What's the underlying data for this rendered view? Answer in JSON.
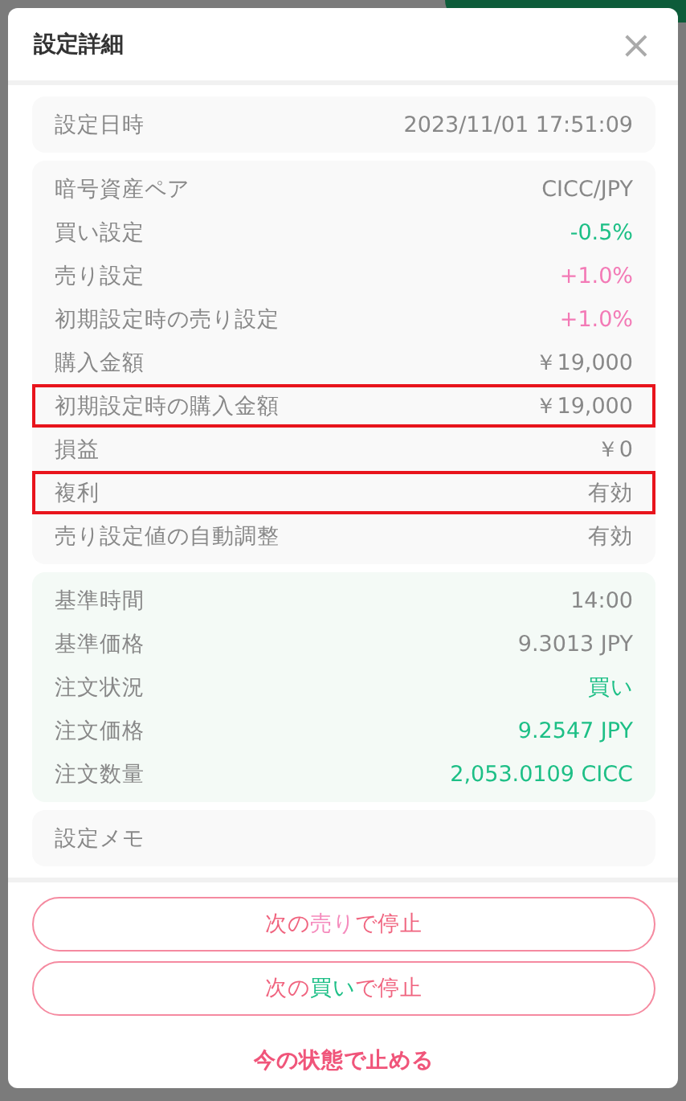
{
  "dialog": {
    "title": "設定詳細",
    "close": "×"
  },
  "sections": [
    {
      "rows": [
        {
          "label": "設定日時",
          "value": "2023/11/01 17:51:09",
          "kind": "plain",
          "highlighted": false
        }
      ]
    },
    {
      "rows": [
        {
          "label": "暗号資産ペア",
          "value": "CICC/JPY",
          "kind": "plain",
          "highlighted": false
        },
        {
          "label": "買い設定",
          "value": "-0.5%",
          "kind": "buy",
          "highlighted": false
        },
        {
          "label": "売り設定",
          "value": "+1.0%",
          "kind": "sell",
          "highlighted": false
        },
        {
          "label": "初期設定時の売り設定",
          "value": "+1.0%",
          "kind": "sell",
          "highlighted": false
        },
        {
          "label": "購入金額",
          "value": "￥19,000",
          "kind": "plain",
          "highlighted": false
        },
        {
          "label": "初期設定時の購入金額",
          "value": "￥19,000",
          "kind": "plain",
          "highlighted": true
        },
        {
          "label": "損益",
          "value": "￥0",
          "kind": "plain",
          "highlighted": false
        },
        {
          "label": "複利",
          "value": "有効",
          "kind": "plain",
          "highlighted": true
        },
        {
          "label": "売り設定値の自動調整",
          "value": "有効",
          "kind": "plain",
          "highlighted": false
        }
      ]
    },
    {
      "rows": [
        {
          "label": "基準時間",
          "value": "14:00",
          "kind": "plain",
          "highlighted": false
        },
        {
          "label": "基準価格",
          "value": "9.3013 JPY",
          "kind": "plain",
          "highlighted": false
        },
        {
          "label": "注文状況",
          "value": "買い",
          "kind": "buy",
          "highlighted": false
        },
        {
          "label": "注文価格",
          "value": "9.2547 JPY",
          "kind": "buy",
          "highlighted": false
        },
        {
          "label": "注文数量",
          "value": "2,053.0109 CICC",
          "kind": "buy",
          "highlighted": false
        }
      ]
    },
    {
      "rows": [
        {
          "label": "設定メモ",
          "highlighted": false
        }
      ]
    }
  ],
  "buttons": [
    {
      "parts": [
        {
          "text": "次の",
          "kind": "plain"
        },
        {
          "text": "売り",
          "kind": "sell"
        },
        {
          "text": "で停止",
          "kind": "plain"
        }
      ]
    },
    {
      "parts": [
        {
          "text": "次の",
          "kind": "plain"
        },
        {
          "text": "買い",
          "kind": "buy"
        },
        {
          "text": "で停止",
          "kind": "plain"
        }
      ]
    }
  ],
  "link": "今の状態で止める"
}
